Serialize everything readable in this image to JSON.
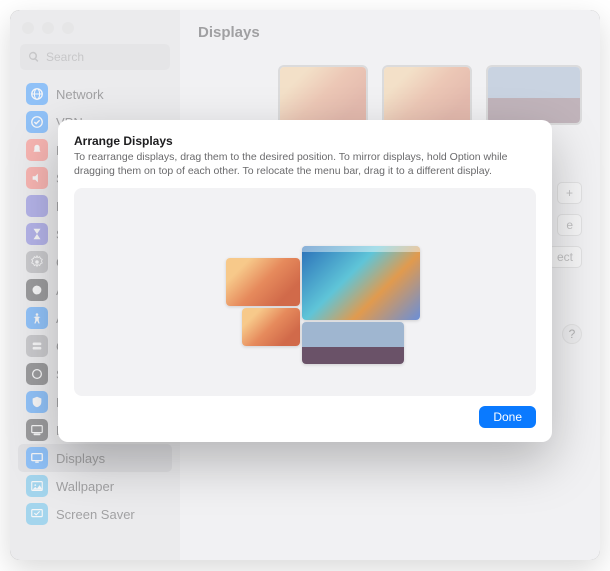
{
  "search": {
    "placeholder": "Search"
  },
  "page": {
    "title": "Displays"
  },
  "sidebar": {
    "items": [
      {
        "label": "Network",
        "icon": "globe-icon",
        "color": "bg-blue"
      },
      {
        "label": "VPN",
        "icon": "vpn-icon",
        "color": "bg-blue"
      },
      {
        "label": "N",
        "icon": "bell-icon",
        "color": "bg-red"
      },
      {
        "label": "S",
        "icon": "sound-icon",
        "color": "bg-red"
      },
      {
        "label": "F",
        "icon": "moon-icon",
        "color": "bg-purple"
      },
      {
        "label": "S",
        "icon": "hourglass-icon",
        "color": "bg-purple"
      },
      {
        "label": "G",
        "icon": "gear-icon",
        "color": "bg-gray"
      },
      {
        "label": "A",
        "icon": "appearance-icon",
        "color": "bg-dark"
      },
      {
        "label": "A",
        "icon": "accessibility-icon",
        "color": "bg-blue"
      },
      {
        "label": "C",
        "icon": "control-icon",
        "color": "bg-gray"
      },
      {
        "label": "S",
        "icon": "siri-icon",
        "color": "bg-dark"
      },
      {
        "label": "P",
        "icon": "privacy-icon",
        "color": "bg-blue"
      },
      {
        "label": "Desktop & Dock",
        "icon": "dock-icon",
        "color": "bg-dark"
      },
      {
        "label": "Displays",
        "icon": "displays-icon",
        "color": "bg-blue",
        "selected": true
      },
      {
        "label": "Wallpaper",
        "icon": "wallpaper-icon",
        "color": "bg-cyan"
      },
      {
        "label": "Screen Saver",
        "icon": "screensaver-icon",
        "color": "bg-cyan"
      }
    ]
  },
  "content": {
    "connect": "ect",
    "plus": "+",
    "e_text": "e",
    "help": "?"
  },
  "modal": {
    "title": "Arrange Displays",
    "body": "To rearrange displays, drag them to the desired position. To mirror displays, hold Option while dragging them on top of each other. To relocate the menu bar, drag it to a different display.",
    "done": "Done"
  }
}
